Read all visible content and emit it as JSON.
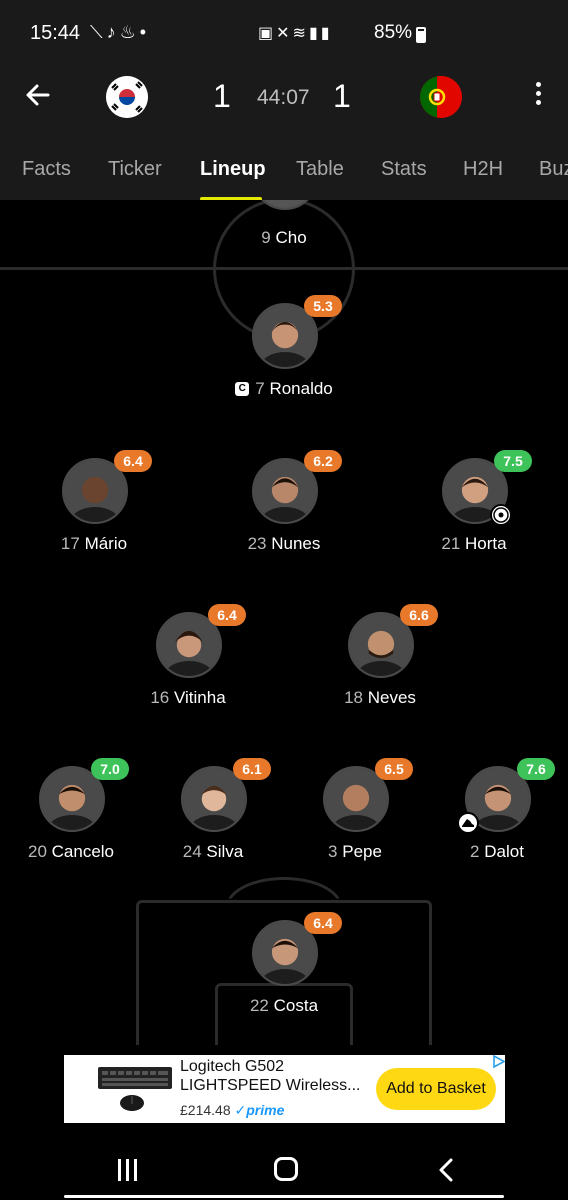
{
  "status_bar": {
    "time": "15:44",
    "left_icons": [
      "signal-app-icon",
      "tiktok-icon",
      "notification-icon",
      "dot-icon"
    ],
    "battery": "85%"
  },
  "match": {
    "home_team_flag": "south-korea-flag",
    "away_team_flag": "portugal-flag",
    "home_score": "1",
    "away_score": "1",
    "clock": "44:07"
  },
  "tabs": [
    {
      "label": "Facts",
      "active": false
    },
    {
      "label": "Ticker",
      "active": false
    },
    {
      "label": "Lineup",
      "active": true
    },
    {
      "label": "Table",
      "active": false
    },
    {
      "label": "Stats",
      "active": false
    },
    {
      "label": "H2H",
      "active": false
    },
    {
      "label": "Buz",
      "active": false
    }
  ],
  "lineup": {
    "opponent_striker": {
      "number": "9",
      "name": "Cho"
    },
    "players": [
      {
        "number": "7",
        "name": "Ronaldo",
        "rating": "5.3",
        "rating_color": "orange",
        "captain": true,
        "captain_label": "C"
      },
      {
        "number": "17",
        "name": "Mário",
        "rating": "6.4",
        "rating_color": "orange"
      },
      {
        "number": "23",
        "name": "Nunes",
        "rating": "6.2",
        "rating_color": "orange"
      },
      {
        "number": "21",
        "name": "Horta",
        "rating": "7.5",
        "rating_color": "green",
        "event": "goal-icon"
      },
      {
        "number": "16",
        "name": "Vitinha",
        "rating": "6.4",
        "rating_color": "orange"
      },
      {
        "number": "18",
        "name": "Neves",
        "rating": "6.6",
        "rating_color": "orange"
      },
      {
        "number": "20",
        "name": "Cancelo",
        "rating": "7.0",
        "rating_color": "green"
      },
      {
        "number": "24",
        "name": "Silva",
        "rating": "6.1",
        "rating_color": "orange"
      },
      {
        "number": "3",
        "name": "Pepe",
        "rating": "6.5",
        "rating_color": "orange"
      },
      {
        "number": "2",
        "name": "Dalot",
        "rating": "7.6",
        "rating_color": "green",
        "event": "assist-boot-icon"
      },
      {
        "number": "22",
        "name": "Costa",
        "rating": "6.4",
        "rating_color": "orange"
      }
    ]
  },
  "ad": {
    "title": "Logitech G502 LIGHTSPEED Wireless...",
    "price": "£214.48",
    "prime": "prime",
    "button": "Add to Basket"
  },
  "colors": {
    "header_bg": "#1a1a1a",
    "tab_indicator": "#e5e800",
    "rating_orange": "#e8792b",
    "rating_green": "#3ec35a",
    "ad_button": "#ffd814"
  }
}
